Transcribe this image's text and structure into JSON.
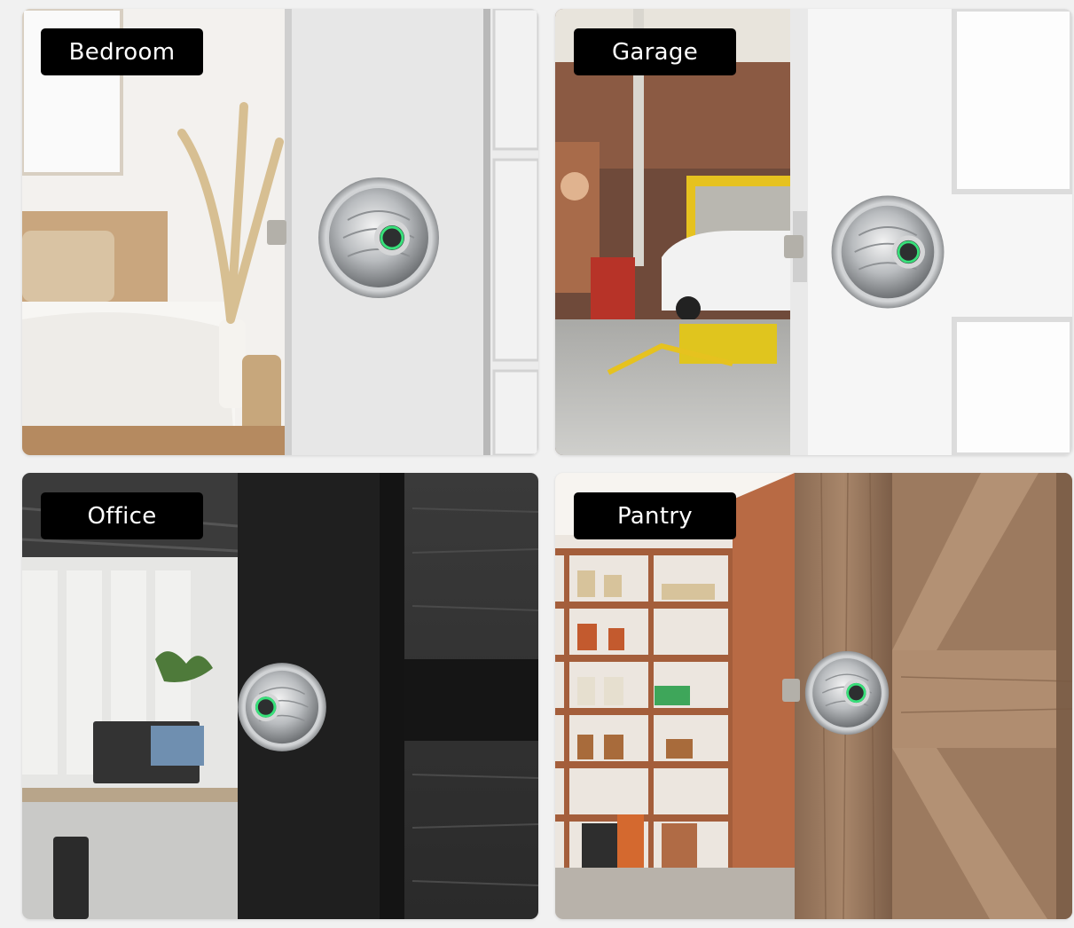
{
  "panels": [
    {
      "label": "Bedroom"
    },
    {
      "label": "Garage"
    },
    {
      "label": "Office"
    },
    {
      "label": "Pantry"
    }
  ],
  "icons": {
    "lock": "fingerprint-door-knob-icon",
    "sensor_color": "#38e07a"
  }
}
